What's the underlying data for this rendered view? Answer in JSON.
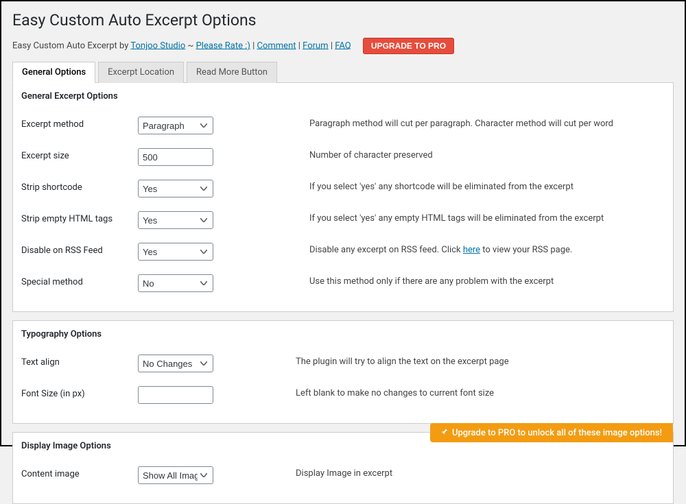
{
  "page_title": "Easy Custom Auto Excerpt Options",
  "subheader": {
    "prefix": "Easy Custom Auto Excerpt by ",
    "studio": "Tonjoo Studio",
    "sep1": " ~ ",
    "rate": "Please Rate :)",
    "sep2": " | ",
    "comment": "Comment",
    "forum": "Forum",
    "faq": "FAQ"
  },
  "upgrade_button": "UPGRADE TO PRO",
  "tabs": {
    "general": "General Options",
    "location": "Excerpt Location",
    "readmore": "Read More Button"
  },
  "sections": {
    "general": {
      "title": "General Excerpt Options",
      "excerpt_method": {
        "label": "Excerpt method",
        "value": "Paragraph",
        "desc": "Paragraph method will cut per paragraph. Character method will cut per word"
      },
      "excerpt_size": {
        "label": "Excerpt size",
        "value": "500",
        "desc": "Number of character preserved"
      },
      "strip_shortcode": {
        "label": "Strip shortcode",
        "value": "Yes",
        "desc": "If you select 'yes' any shortcode will be eliminated from the excerpt"
      },
      "strip_empty": {
        "label": "Strip empty HTML tags",
        "value": "Yes",
        "desc": "If you select 'yes' any empty HTML tags will be eliminated from the excerpt"
      },
      "disable_rss": {
        "label": "Disable on RSS Feed",
        "value": "Yes",
        "desc_pre": "Disable any excerpt on RSS feed. Click ",
        "desc_link": "here",
        "desc_post": " to view your RSS page."
      },
      "special_method": {
        "label": "Special method",
        "value": "No",
        "desc": "Use this method only if there are any problem with the excerpt"
      }
    },
    "typography": {
      "title": "Typography Options",
      "text_align": {
        "label": "Text align",
        "value": "No Changes",
        "desc": "The plugin will try to align the text on the excerpt page"
      },
      "font_size": {
        "label": "Font Size (in px)",
        "value": "",
        "desc": "Left blank to make no changes to current font size"
      }
    },
    "display_image": {
      "title": "Display Image Options",
      "banner": "Upgrade to PRO to unlock all of these image options!",
      "content_image": {
        "label": "Content image",
        "value": "Show All Images",
        "desc": "Display Image in excerpt"
      }
    }
  }
}
